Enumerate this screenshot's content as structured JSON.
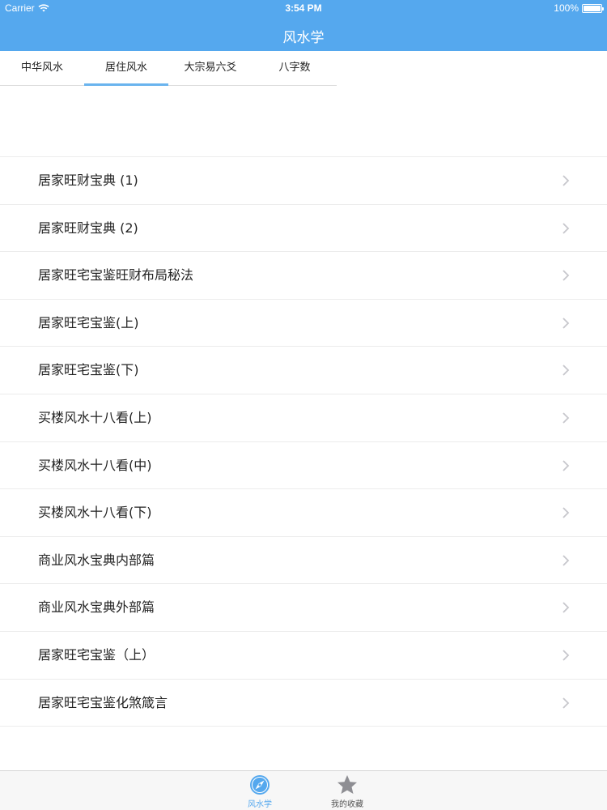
{
  "status_bar": {
    "carrier": "Carrier",
    "time": "3:54 PM",
    "battery": "100%"
  },
  "nav": {
    "title": "风水学"
  },
  "tabs": [
    {
      "label": "中华风水",
      "active": false
    },
    {
      "label": "居住风水",
      "active": true
    },
    {
      "label": "大宗易六爻",
      "active": false
    },
    {
      "label": "八字数",
      "active": false
    }
  ],
  "list": {
    "items": [
      {
        "label": "居家旺财宝典 (1)"
      },
      {
        "label": "居家旺财宝典 (2)"
      },
      {
        "label": "居家旺宅宝鉴旺财布局秘法"
      },
      {
        "label": "居家旺宅宝鉴(上)"
      },
      {
        "label": "居家旺宅宝鉴(下)"
      },
      {
        "label": "买楼风水十八看(上)"
      },
      {
        "label": "买楼风水十八看(中)"
      },
      {
        "label": "买楼风水十八看(下)"
      },
      {
        "label": "商业风水宝典内部篇"
      },
      {
        "label": "商业风水宝典外部篇"
      },
      {
        "label": "居家旺宅宝鉴（上）"
      },
      {
        "label": "居家旺宅宝鉴化煞箴言"
      }
    ]
  },
  "tabbar": {
    "items": [
      {
        "label": "风水学",
        "icon": "compass-icon",
        "active": true,
        "color": "#55a8ee"
      },
      {
        "label": "我的收藏",
        "icon": "star-icon",
        "active": false,
        "color": "#8e8e93"
      }
    ]
  },
  "colors": {
    "accent": "#55a8ee",
    "tab_underline": "#6ab4ee",
    "chevron": "#c7c7cc"
  }
}
